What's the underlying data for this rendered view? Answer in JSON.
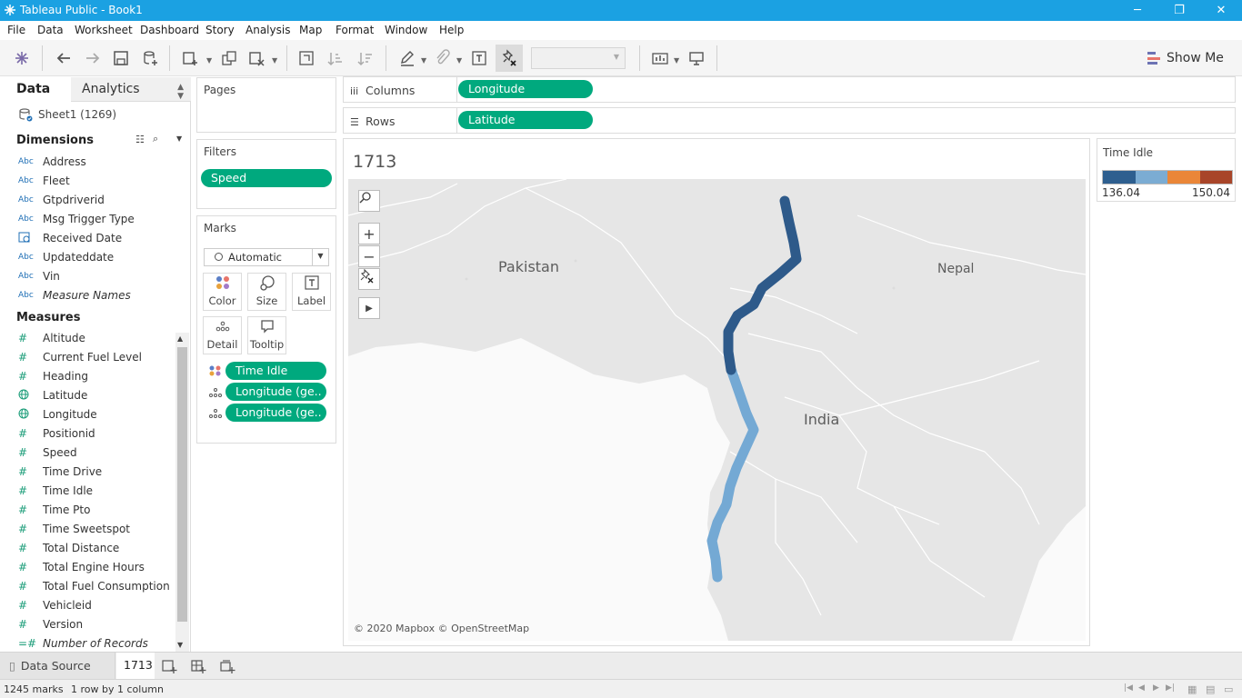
{
  "window": {
    "title": "Tableau Public - Book1",
    "minimize": "─",
    "restore": "❐",
    "close": "✕"
  },
  "menu": [
    "File",
    "Data",
    "Worksheet",
    "Dashboard",
    "Story",
    "Analysis",
    "Map",
    "Format",
    "Window",
    "Help"
  ],
  "toolbar": {
    "show_me_label": "Show Me",
    "fit_combo_value": ""
  },
  "data_pane": {
    "tab_data": "Data",
    "tab_analytics": "Analytics",
    "datasource": "Sheet1 (1269)",
    "dimensions_header": "Dimensions",
    "dimensions": [
      {
        "type": "Abc",
        "name": "Address",
        "italic": false
      },
      {
        "type": "Abc",
        "name": "Fleet",
        "italic": false
      },
      {
        "type": "Abc",
        "name": "Gtpdriverid",
        "italic": false
      },
      {
        "type": "Abc",
        "name": "Msg Trigger Type",
        "italic": false
      },
      {
        "type": "date",
        "name": "Received Date",
        "italic": false
      },
      {
        "type": "Abc",
        "name": "Updateddate",
        "italic": false
      },
      {
        "type": "Abc",
        "name": "Vin",
        "italic": false
      },
      {
        "type": "Abc",
        "name": "Measure Names",
        "italic": true
      }
    ],
    "measures_header": "Measures",
    "measures": [
      {
        "type": "#",
        "name": "Altitude"
      },
      {
        "type": "#",
        "name": "Current Fuel Level"
      },
      {
        "type": "#",
        "name": "Heading"
      },
      {
        "type": "geo",
        "name": "Latitude"
      },
      {
        "type": "geo",
        "name": "Longitude"
      },
      {
        "type": "#",
        "name": "Positionid"
      },
      {
        "type": "#",
        "name": "Speed"
      },
      {
        "type": "#",
        "name": "Time Drive"
      },
      {
        "type": "#",
        "name": "Time Idle"
      },
      {
        "type": "#",
        "name": "Time Pto"
      },
      {
        "type": "#",
        "name": "Time Sweetspot"
      },
      {
        "type": "#",
        "name": "Total Distance"
      },
      {
        "type": "#",
        "name": "Total Engine Hours"
      },
      {
        "type": "#",
        "name": "Total Fuel Consumption"
      },
      {
        "type": "#",
        "name": "Vehicleid"
      },
      {
        "type": "#",
        "name": "Version"
      },
      {
        "type": "=#",
        "name": "Number of Records"
      }
    ]
  },
  "pages": {
    "title": "Pages"
  },
  "filters": {
    "title": "Filters",
    "pills": [
      "Speed"
    ]
  },
  "marks": {
    "title": "Marks",
    "type": "Automatic",
    "buttons": [
      "Color",
      "Size",
      "Label",
      "Detail",
      "Tooltip"
    ],
    "pills": [
      "Time Idle",
      "Longitude (ge..",
      "Longitude (ge.."
    ]
  },
  "shelves": {
    "columns_label": "Columns",
    "columns_pill": "Longitude",
    "rows_label": "Rows",
    "rows_pill": "Latitude"
  },
  "view": {
    "title": "1713",
    "map_labels": {
      "pakistan": "Pakistan",
      "india": "India",
      "nepal": "Nepal"
    },
    "copyright": "© 2020 Mapbox © OpenStreetMap"
  },
  "legend": {
    "title": "Time Idle",
    "min": "136.04",
    "max": "150.04",
    "colors": [
      "#2e5f8f",
      "#7bacd3",
      "#ea8638",
      "#a84529"
    ]
  },
  "route_colors": {
    "dark": "#2e5a8a",
    "light": "#74a9d4"
  },
  "sheet_tabs": {
    "data_source": "Data Source",
    "sheet": "1713"
  },
  "status": {
    "marks": "1245 marks",
    "dims": "1 row by 1 column"
  }
}
